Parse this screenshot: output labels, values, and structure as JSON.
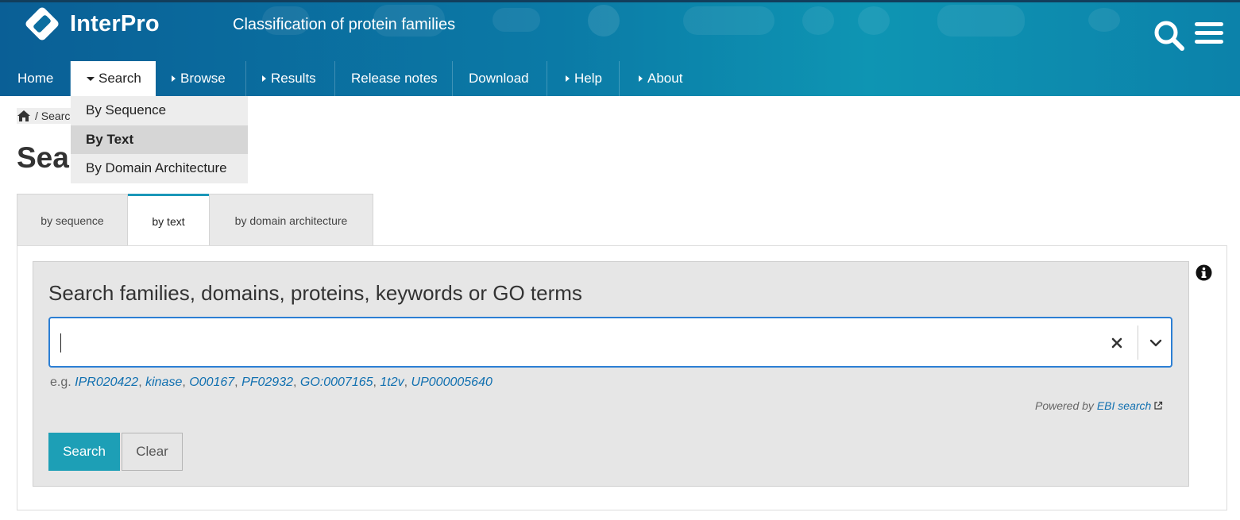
{
  "header": {
    "logo_text": "InterPro",
    "tagline": "Classification of protein families",
    "colors": {
      "brand_dark": "#0a5f96",
      "brand_light": "#0e95b3",
      "accent": "#1d9fb6",
      "link": "#1170b0"
    }
  },
  "nav": {
    "items": [
      {
        "label": "Home",
        "caret": false
      },
      {
        "label": "Search",
        "caret": true,
        "active": true
      },
      {
        "label": "Browse",
        "caret": true
      },
      {
        "label": "Results",
        "caret": true
      },
      {
        "label": "Release notes",
        "caret": false
      },
      {
        "label": "Download",
        "caret": false
      },
      {
        "label": "Help",
        "caret": true
      },
      {
        "label": "About",
        "caret": true
      }
    ]
  },
  "dropdown": {
    "items": [
      {
        "label": "By Sequence"
      },
      {
        "label": "By Text",
        "selected": true
      },
      {
        "label": "By Domain Architecture"
      }
    ]
  },
  "breadcrumb": {
    "separator": "/",
    "current": "Searc"
  },
  "page": {
    "title": "Sear"
  },
  "tabs": [
    {
      "label": "by sequence"
    },
    {
      "label": "by text",
      "active": true
    },
    {
      "label": "by domain architecture"
    }
  ],
  "search": {
    "heading": "Search families, domains, proteins, keywords or GO terms",
    "input_value": "",
    "examples_prefix": "e.g.",
    "examples": [
      "IPR020422",
      "kinase",
      "O00167",
      "PF02932",
      "GO:0007165",
      "1t2v",
      "UP000005640"
    ],
    "powered_by_prefix": "Powered by",
    "powered_by_link": "EBI search",
    "search_button": "Search",
    "clear_button": "Clear"
  }
}
